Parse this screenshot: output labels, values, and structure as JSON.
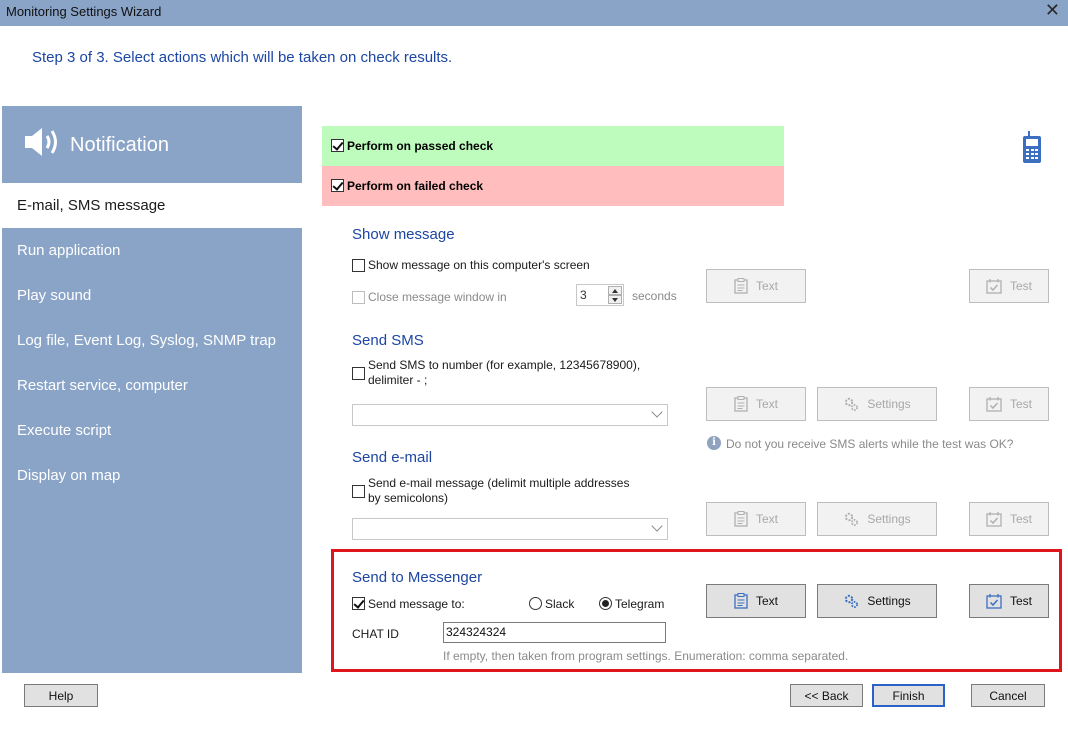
{
  "window": {
    "title": "Monitoring Settings Wizard",
    "close_glyph": "✕"
  },
  "step_header": "Step 3 of 3. Select actions which will be taken on check results.",
  "sidebar": {
    "title": "Notification",
    "items": [
      {
        "label": "E-mail, SMS message",
        "selected": true
      },
      {
        "label": "Run application"
      },
      {
        "label": "Play sound"
      },
      {
        "label": "Log file, Event Log, Syslog, SNMP trap"
      },
      {
        "label": "Restart service, computer"
      },
      {
        "label": "Execute script"
      },
      {
        "label": "Display on map"
      }
    ]
  },
  "perform": {
    "passed_label": "Perform on passed check",
    "failed_label": "Perform on failed check",
    "passed_checked": true,
    "failed_checked": true,
    "passed_color": "#bdfcbd",
    "failed_color": "#ffbdbd"
  },
  "show_message": {
    "title": "Show message",
    "option_label": "Show message on this computer's screen",
    "close_label": "Close message window in",
    "seconds_value": "3",
    "seconds_label": "seconds",
    "text_button": "Text",
    "test_button": "Test"
  },
  "send_sms": {
    "title": "Send SMS",
    "option_label_line1": "Send SMS to number (for example, 12345678900),",
    "option_label_line2": "delimiter - ;",
    "text_button": "Text",
    "settings_button": "Settings",
    "test_button": "Test",
    "info_text": "Do not you receive SMS alerts while the test was OK?"
  },
  "send_email": {
    "title": "Send e-mail",
    "option_label_line1": "Send e-mail message (delimit multiple addresses",
    "option_label_line2": "by semicolons)",
    "text_button": "Text",
    "settings_button": "Settings",
    "test_button": "Test"
  },
  "messenger": {
    "title": "Send to Messenger",
    "option_label": "Send message to:",
    "option_checked": true,
    "radio_slack": "Slack",
    "radio_telegram": "Telegram",
    "selected": "Telegram",
    "chat_id_label": "CHAT ID",
    "chat_id_value": "324324324",
    "hint": "If empty, then taken from program settings. Enumeration: comma separated.",
    "text_button": "Text",
    "settings_button": "Settings",
    "test_button": "Test",
    "highlight_color": "#e0141c"
  },
  "footer": {
    "help": "Help",
    "back": "<< Back",
    "finish": "Finish",
    "cancel": "Cancel"
  },
  "colors": {
    "sidebar": "#8aa4c8",
    "accent_text": "#1c46a4"
  },
  "icons": [
    "speaker-icon",
    "phone-icon",
    "document-icon",
    "gear-icon",
    "calendar-check-icon",
    "info-icon",
    "chevron-down-icon"
  ]
}
